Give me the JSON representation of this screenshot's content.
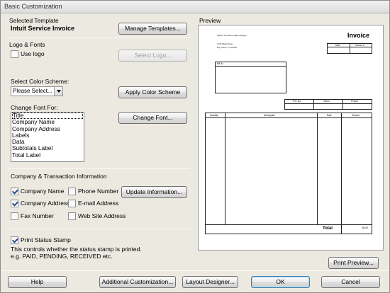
{
  "window": {
    "title": "Basic Customization"
  },
  "template": {
    "section_label": "Selected Template",
    "name": "Intuit Service Invoice",
    "manage_button": "Manage Templates..."
  },
  "logo": {
    "section_label": "Logo & Fonts",
    "use_logo_label": "Use logo",
    "use_logo_checked": false,
    "select_logo_button": "Select Logo..."
  },
  "color": {
    "label": "Select Color Scheme:",
    "selected": "Please Select...",
    "apply_button": "Apply Color Scheme"
  },
  "font": {
    "label": "Change Font For:",
    "items": [
      "Title",
      "Company Name",
      "Company Address",
      "Labels",
      "Data",
      "Subtotals Label",
      "Total Label"
    ],
    "selected_index": 0,
    "change_button": "Change Font..."
  },
  "company": {
    "section_label": "Company & Transaction Information",
    "checks": [
      {
        "label": "Company Name",
        "checked": true
      },
      {
        "label": "Phone Number",
        "checked": false
      },
      {
        "label": "Company Address",
        "checked": true
      },
      {
        "label": "E-mail Address",
        "checked": false
      },
      {
        "label": "Fax Number",
        "checked": false
      },
      {
        "label": "Web Site Address",
        "checked": false
      }
    ],
    "update_button": "Update Information..."
  },
  "status_stamp": {
    "label": "Print Status Stamp",
    "checked": true,
    "description_line1": "This controls whether the status stamp is printed.",
    "description_line2": "e.g. PAID, PENDING, RECEIVED etc."
  },
  "preview": {
    "label": "Preview",
    "company_name": "Mark's Acronis Graphic Designs",
    "address_line1": "1045 Main Street",
    "address_line2": "Bay Shore, CA 94326",
    "invoice_title": "Invoice",
    "date_label": "Date",
    "invoice_no_label": "Invoice #",
    "bill_to_label": "Bill To",
    "po_label": "P.O. No.",
    "terms_label": "Terms",
    "project_label": "Project",
    "quantity_label": "Quantity",
    "description_label": "Description",
    "rate_label": "Rate",
    "amount_label": "Amount",
    "total_label": "Total",
    "total_value": "$0.00",
    "print_preview_button": "Print Preview..."
  },
  "footer": {
    "help": "Help",
    "additional": "Additional Customization...",
    "layout": "Layout Designer...",
    "ok": "OK",
    "cancel": "Cancel"
  }
}
